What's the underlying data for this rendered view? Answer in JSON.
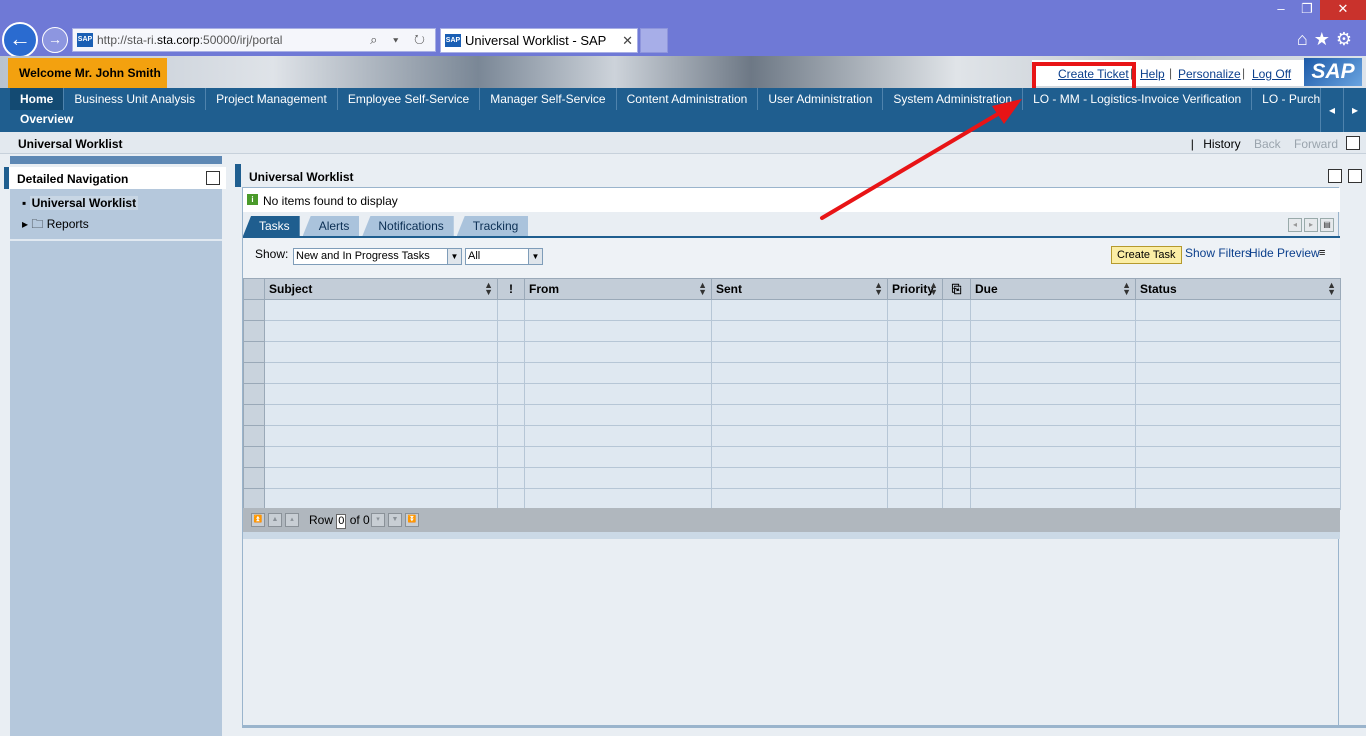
{
  "browser": {
    "url_prefix": "http://sta-ri.",
    "url_host": "sta.corp",
    "url_suffix": ":50000/irj/portal",
    "tab_title": "Universal Worklist - SAP Ne...",
    "tab_close": "✕",
    "back_icon": "←",
    "forward_icon": "→",
    "addr_controls": "⌕ ▾ ↻",
    "win_min": "–",
    "win_restore": "❐",
    "win_close": "✕",
    "toolbar_icons": "⌂★⚙",
    "favicon_text": "SAP"
  },
  "header": {
    "welcome": "Welcome Mr. John Smith",
    "links": {
      "create_ticket": "Create Ticket",
      "help": "Help",
      "personalize": "Personalize",
      "log_off": "Log Off"
    },
    "separator": "|",
    "logo": "SAP"
  },
  "topnav": {
    "tabs": [
      {
        "label": "Home",
        "active": true
      },
      {
        "label": "Business Unit Analysis"
      },
      {
        "label": "Project Management"
      },
      {
        "label": "Employee Self-Service"
      },
      {
        "label": "Manager Self-Service"
      },
      {
        "label": "Content Administration"
      },
      {
        "label": "User Administration"
      },
      {
        "label": "System Administration"
      },
      {
        "label": "LO - MM - Logistics-Invoice Verification"
      },
      {
        "label": "LO - Purchasing - Maste"
      }
    ],
    "subnav": "Overview",
    "prev": "◂",
    "next": "▸"
  },
  "pagebar": {
    "title": "Universal Worklist",
    "history_sep": "|",
    "history": "History",
    "back": "Back",
    "forward": "Forward"
  },
  "left": {
    "title": "Detailed Navigation",
    "items": [
      {
        "label": "Universal Worklist",
        "bullet": "▪"
      },
      {
        "label": "Reports",
        "bullet": "▸ 🗀"
      }
    ]
  },
  "main": {
    "title": "Universal Worklist",
    "message": "No items found to display",
    "message_icon": "i",
    "subtabs": [
      "Tasks",
      "Alerts",
      "Notifications",
      "Tracking"
    ],
    "show_label": "Show:",
    "select_tasks": "New and In Progress Tasks",
    "select_all": "All",
    "dropdown_icon": "▼",
    "create_task": "Create Task",
    "show_filters": "Show Filters",
    "hide_preview": "Hide Preview",
    "filter_icon": "≡",
    "columns": [
      "Subject",
      "!",
      "From",
      "Sent",
      "Priority",
      "⎘",
      "Due",
      "Status"
    ],
    "sort_icon": "▲▼",
    "empty_rows": 10,
    "footer": {
      "row_label": "Row",
      "row_value": "0",
      "of_label": "of 0"
    }
  },
  "colors": {
    "nav_blue": "#1f5e8f",
    "welcome_orange": "#f3a10f",
    "highlight_red": "#e81416"
  }
}
